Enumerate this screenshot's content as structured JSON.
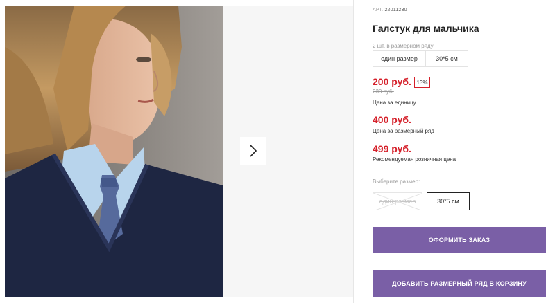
{
  "gallery": {
    "photo_alt": "Галстук для мальчика",
    "next_icon": "chevron-right-icon"
  },
  "product": {
    "article_label": "АРТ.",
    "article_number": "22011230",
    "title": "Галстук для мальчика",
    "sizes_in_row": "2 шт. в размерном ряду",
    "row_sizes": [
      "один размер",
      "30*5 см"
    ]
  },
  "prices": {
    "unit_price": "200 руб.",
    "discount": "13%",
    "old_price": "230 руб.",
    "unit_caption": "Цена за единицу",
    "row_price": "400 руб.",
    "row_caption": "Цена за размерный ряд",
    "retail_price": "499 руб.",
    "retail_caption": "Рекомендуемая розничная цена"
  },
  "size_picker": {
    "label": "Выберите размер:",
    "options": [
      {
        "label": "один размер",
        "available": false
      },
      {
        "label": "30*5 см",
        "available": true,
        "selected": true
      }
    ]
  },
  "actions": {
    "order_label": "Оформить заказ",
    "add_row_label": "Добавить размерный ряд в корзину"
  },
  "colors": {
    "accent": "#7a5fa6",
    "price": "#d5202a"
  }
}
